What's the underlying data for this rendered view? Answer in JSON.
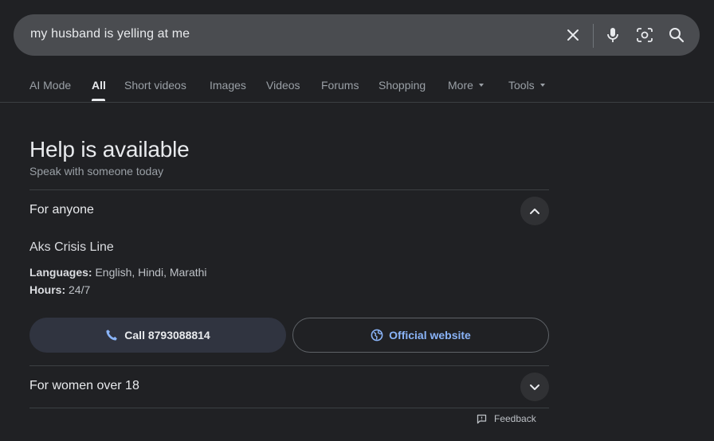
{
  "search": {
    "query": "my husband is yelling at me",
    "icons": [
      "close-icon",
      "microphone-icon",
      "lens-camera-icon",
      "search-icon"
    ]
  },
  "tabs": [
    {
      "label": "AI Mode",
      "active": false
    },
    {
      "label": "All",
      "active": true
    },
    {
      "label": "Short videos",
      "active": false
    },
    {
      "label": "Images",
      "active": false
    },
    {
      "label": "Videos",
      "active": false
    },
    {
      "label": "Forums",
      "active": false
    },
    {
      "label": "Shopping",
      "active": false
    },
    {
      "label": "More",
      "active": false,
      "dropdown": true
    },
    {
      "label": "Tools",
      "active": false,
      "dropdown": true
    }
  ],
  "help": {
    "title": "Help is available",
    "subtitle": "Speak with someone today"
  },
  "sections": [
    {
      "title": "For anyone",
      "expanded": true,
      "org_name": "Aks Crisis Line",
      "languages_label": "Languages:",
      "languages_value": "English, Hindi, Marathi",
      "hours_label": "Hours:",
      "hours_value": "24/7",
      "call_label": "Call 8793088814",
      "website_label": "Official website"
    },
    {
      "title": "For women over 18",
      "expanded": false
    }
  ],
  "feedback": {
    "label": "Feedback"
  },
  "colors": {
    "background": "#202124",
    "search_bar": "#4a4c50",
    "link_blue": "#8ab4f8",
    "call_button": "#303440"
  }
}
